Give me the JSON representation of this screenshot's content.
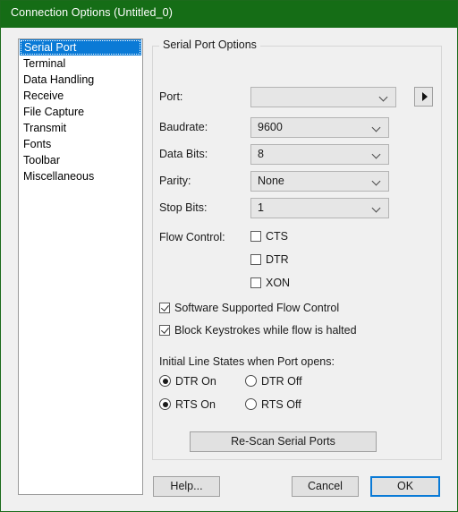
{
  "window": {
    "title": "Connection Options (Untitled_0)",
    "titlebar_color": "#156d16",
    "accent_color": "#0a7ad6",
    "face_color": "#f0f0f0"
  },
  "sidebar": {
    "items": [
      {
        "label": "Serial Port",
        "selected": true
      },
      {
        "label": "Terminal",
        "selected": false
      },
      {
        "label": "Data Handling",
        "selected": false
      },
      {
        "label": "Receive",
        "selected": false
      },
      {
        "label": "File Capture",
        "selected": false
      },
      {
        "label": "Transmit",
        "selected": false
      },
      {
        "label": "Fonts",
        "selected": false
      },
      {
        "label": "Toolbar",
        "selected": false
      },
      {
        "label": "Miscellaneous",
        "selected": false
      }
    ]
  },
  "group": {
    "legend": "Serial Port Options"
  },
  "fields": {
    "port": {
      "label": "Port:",
      "value": ""
    },
    "baudrate": {
      "label": "Baudrate:",
      "value": "9600"
    },
    "data_bits": {
      "label": "Data Bits:",
      "value": "8"
    },
    "parity": {
      "label": "Parity:",
      "value": "None"
    },
    "stop_bits": {
      "label": "Stop Bits:",
      "value": "1"
    }
  },
  "port_expand_button": {
    "glyph": "right-triangle"
  },
  "flow_control": {
    "label": "Flow Control:",
    "options": [
      {
        "label": "CTS",
        "checked": false
      },
      {
        "label": "DTR",
        "checked": false
      },
      {
        "label": "XON",
        "checked": false
      }
    ]
  },
  "software_flow": {
    "options": [
      {
        "label": "Software Supported Flow Control",
        "checked": true
      },
      {
        "label": "Block Keystrokes while flow is halted",
        "checked": true
      }
    ]
  },
  "line_states": {
    "title": "Initial Line States when Port opens:",
    "options": [
      {
        "label": "DTR On",
        "checked": true
      },
      {
        "label": "DTR Off",
        "checked": false
      },
      {
        "label": "RTS On",
        "checked": true
      },
      {
        "label": "RTS Off",
        "checked": false
      }
    ]
  },
  "rescan_button": {
    "label": "Re-Scan Serial Ports"
  },
  "footer": {
    "help": "Help...",
    "cancel": "Cancel",
    "ok": "OK"
  }
}
